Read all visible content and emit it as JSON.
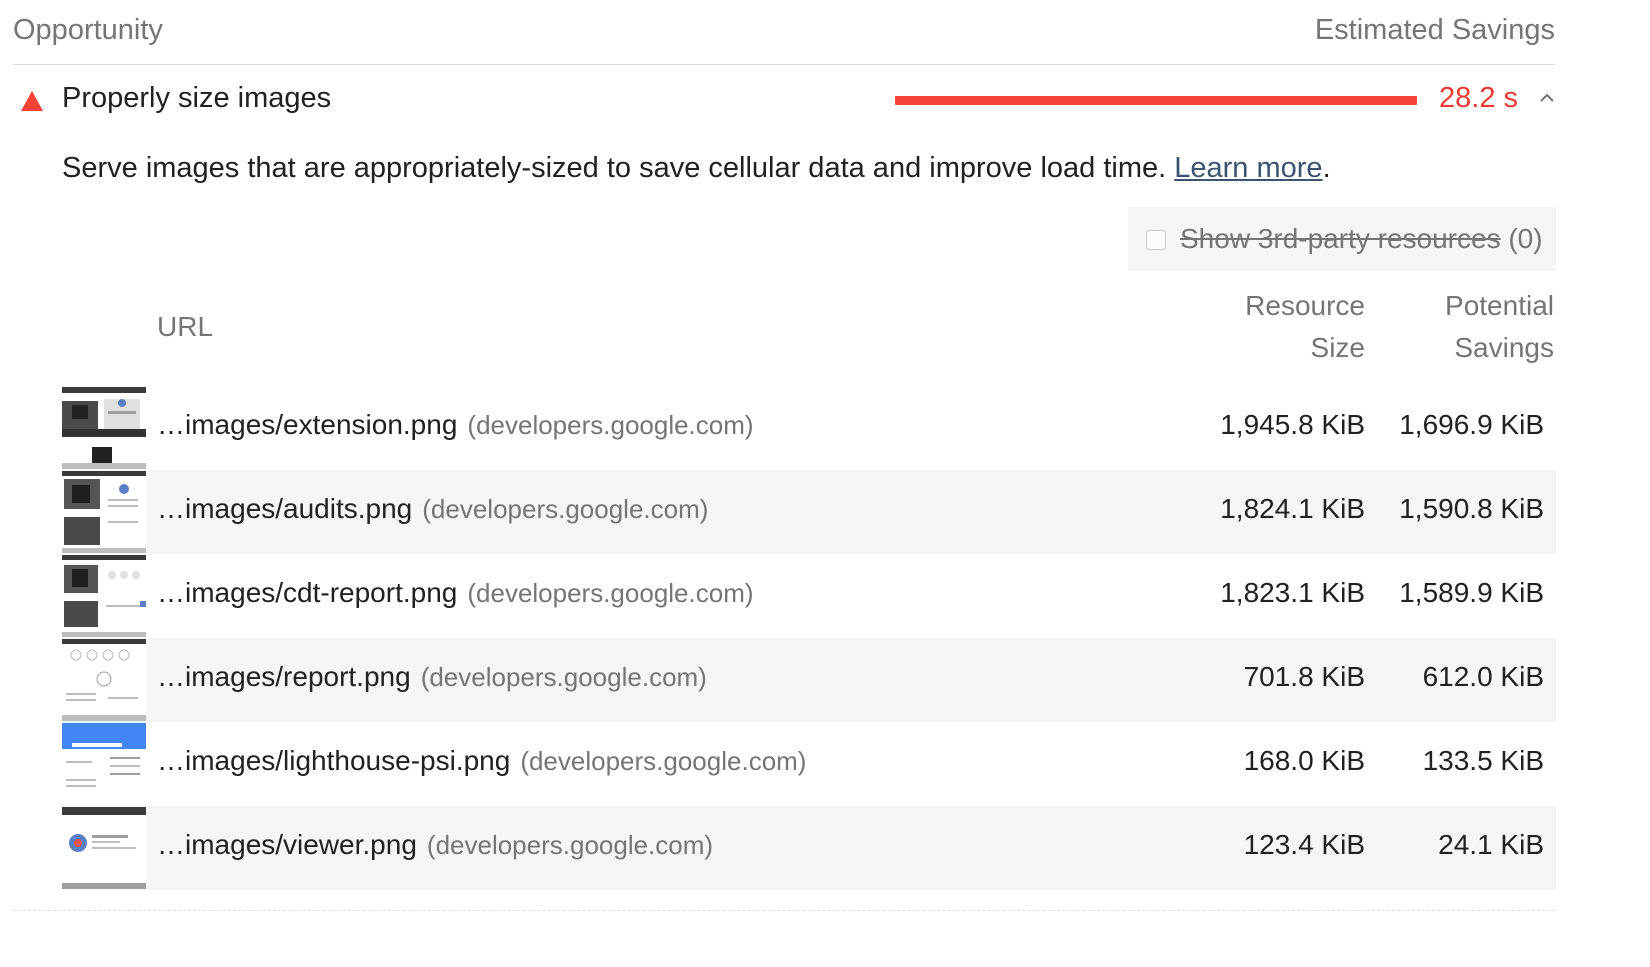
{
  "header": {
    "opportunity_label": "Opportunity",
    "estimated_savings_label": "Estimated Savings"
  },
  "audit": {
    "status_icon": "warning-triangle-icon",
    "title": "Properly size images",
    "savings_fraction": 1.0,
    "savings_value": "28.2 s",
    "collapse_icon": "chevron-up-icon",
    "color_fail": "#f44336"
  },
  "description": {
    "text": "Serve images that are appropriately-sized to save cellular data and improve load time.",
    "link_label": "Learn more",
    "suffix": "."
  },
  "filter": {
    "label": "Show 3rd-party resources",
    "count": "(0)",
    "checked": false
  },
  "table": {
    "columns": {
      "url": "URL",
      "resource_size_line1": "Resource",
      "resource_size_line2": "Size",
      "potential_savings_line1": "Potential",
      "potential_savings_line2": "Savings"
    },
    "rows": [
      {
        "url": "…images/extension.png",
        "host": "(developers.google.com)",
        "resource_size": "1,945.8 KiB",
        "potential_savings": "1,696.9 KiB"
      },
      {
        "url": "…images/audits.png",
        "host": "(developers.google.com)",
        "resource_size": "1,824.1 KiB",
        "potential_savings": "1,590.8 KiB"
      },
      {
        "url": "…images/cdt-report.png",
        "host": "(developers.google.com)",
        "resource_size": "1,823.1 KiB",
        "potential_savings": "1,589.9 KiB"
      },
      {
        "url": "…images/report.png",
        "host": "(developers.google.com)",
        "resource_size": "701.8 KiB",
        "potential_savings": "612.0 KiB"
      },
      {
        "url": "…images/lighthouse-psi.png",
        "host": "(developers.google.com)",
        "resource_size": "168.0 KiB",
        "potential_savings": "133.5 KiB"
      },
      {
        "url": "…images/viewer.png",
        "host": "(developers.google.com)",
        "resource_size": "123.4 KiB",
        "potential_savings": "24.1 KiB"
      }
    ]
  }
}
